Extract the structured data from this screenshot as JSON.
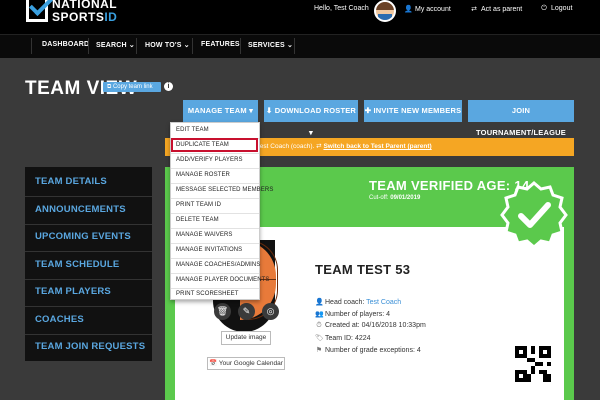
{
  "brand": {
    "line1": "NATIONAL",
    "line2_a": "SPORTS",
    "line2_b": "ID",
    "accent": "#3aa0e0"
  },
  "header": {
    "greeting": "Hello, Test Coach",
    "links": [
      {
        "icon": "user-icon",
        "glyph": "👤",
        "label": "My account"
      },
      {
        "icon": "swap-icon",
        "glyph": "⇄",
        "label": "Act as parent"
      },
      {
        "icon": "logout-icon",
        "glyph": "⏻",
        "label": "Logout"
      }
    ]
  },
  "nav": [
    "DASHBOARD",
    "SEARCH",
    "HOW TO'S",
    "FEATURES",
    "SERVICES"
  ],
  "nav_caret": "⌄",
  "page": {
    "title": "TEAM VIEW",
    "copy_link": "Copy team link",
    "info": "i"
  },
  "actions": {
    "manage_team": "MANAGE TEAM",
    "download_roster": "DOWNLOAD ROSTER",
    "invite": "INVITE NEW MEMBERS",
    "join": "JOIN TOURNAMENT/LEAGUE"
  },
  "dropdown": [
    "EDIT TEAM",
    "DUPLICATE TEAM",
    "ADD/VERIFY PLAYERS",
    "MANAGE ROSTER",
    "MESSAGE SELECTED MEMBERS",
    "PRINT TEAM ID",
    "DELETE TEAM",
    "MANAGE WAIVERS",
    "MANAGE INVITATIONS",
    "MANAGE COACHES/ADMINS",
    "MANAGE PLAYER DOCUMENTS",
    "PRINT SCORESHEET"
  ],
  "banner": {
    "prefix": "test Coach (coach).",
    "link": "Switch back to Test Parent (parent)"
  },
  "sidebar": [
    "TEAM DETAILS",
    "ANNOUNCEMENTS",
    "UPCOMING EVENTS",
    "TEAM SCHEDULE",
    "TEAM PLAYERS",
    "COACHES",
    "TEAM JOIN REQUESTS"
  ],
  "team": {
    "verified": "TEAM VERIFIED AGE: 14",
    "cutoff_label": "Cut-off:",
    "cutoff_date": "09/01/2019",
    "name": "TEAM TEST 53",
    "update_image": "Update image",
    "calendar": "Your Google Calendar",
    "details": {
      "head_coach_label": "Head coach:",
      "head_coach": "Test Coach",
      "players": "Number of players: 4",
      "created": "Created at: 04/16/2018 10:33pm",
      "team_id": "Team ID: 4224",
      "exceptions": "Number of grade exceptions: 4"
    }
  },
  "colors": {
    "accent_blue": "#5aa7e0",
    "green": "#5bc94c",
    "orange": "#f5a623",
    "highlight": "#c8102e"
  }
}
